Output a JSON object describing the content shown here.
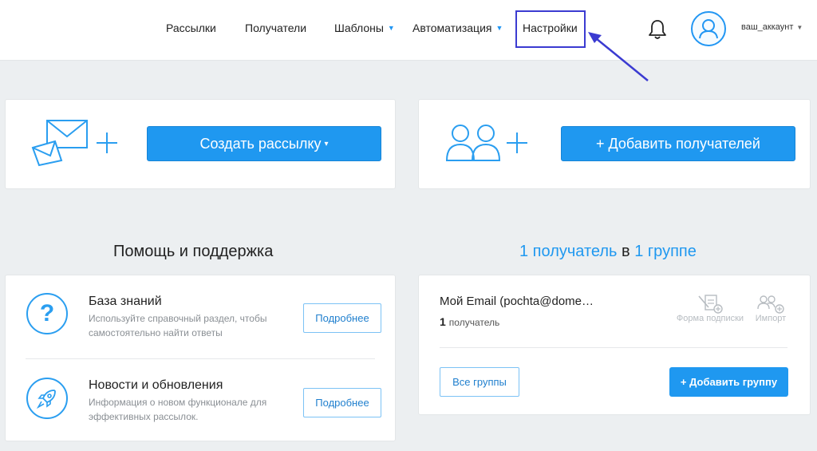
{
  "nav": {
    "items": [
      {
        "label": "Рассылки"
      },
      {
        "label": "Получатели"
      },
      {
        "label": "Шаблоны"
      },
      {
        "label": "Автоматизация"
      },
      {
        "label": "Настройки"
      }
    ],
    "caret": "▼",
    "account": "ваш_аккаунт",
    "bell_icon": "bell-icon",
    "avatar_icon": "user-icon"
  },
  "top": {
    "create_label": "Создать рассылку",
    "create_caret": "▾",
    "add_recipients_label": "+ Добавить получателей"
  },
  "help": {
    "title": "Помощь и поддержка",
    "items": [
      {
        "title": "База знаний",
        "description": "Используйте справочный раздел, чтобы самостоятельно найти ответы",
        "button": "Подробнее",
        "icon": "question-icon",
        "icon_text": "?"
      },
      {
        "title": "Новости и обновления",
        "description": "Информация о новом функционале для эффективных рассылок.",
        "button": "Подробнее",
        "icon": "rocket-icon"
      }
    ]
  },
  "recipients": {
    "count_link": "1 получатель",
    "connector": " в ",
    "group_link": "1 группе",
    "group": {
      "name": "Мой Email (pochta@dome…",
      "count": "1",
      "count_label": "получатель"
    },
    "tools": [
      {
        "label": "Форма подписки",
        "icon": "subscription-form-icon"
      },
      {
        "label": "Импорт",
        "icon": "import-users-icon"
      }
    ],
    "all_groups": "Все группы",
    "add_group": "+ Добавить группу"
  },
  "colors": {
    "accent": "#1f98f0",
    "highlight_box": "#3b3bd1"
  }
}
